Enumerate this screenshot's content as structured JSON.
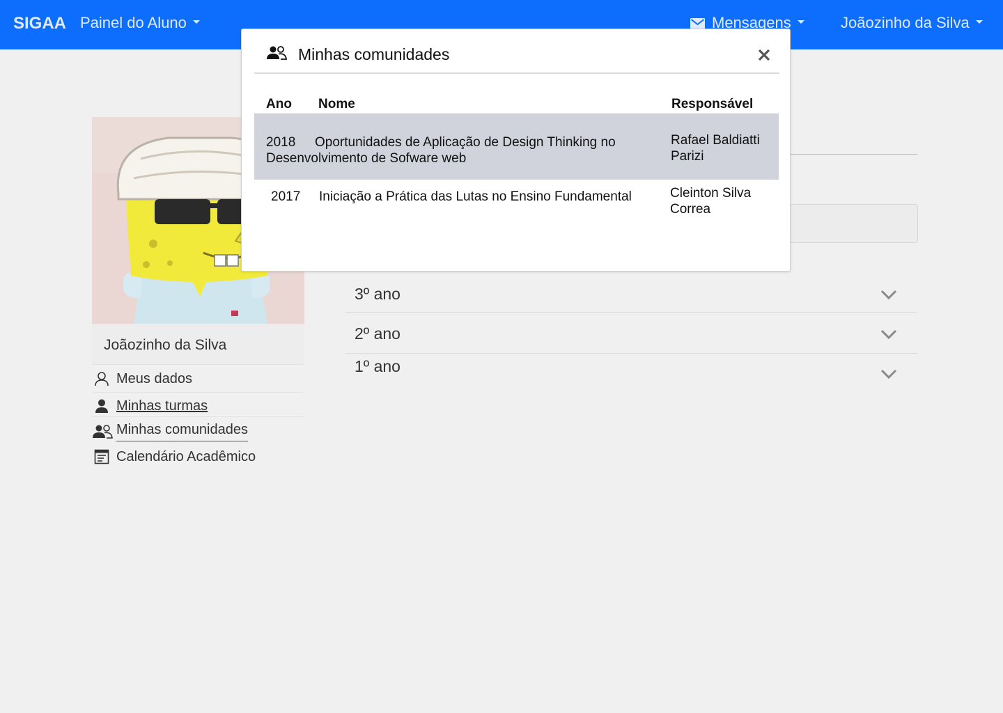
{
  "navbar": {
    "brand": "SIGAA",
    "panel_label": "Painel do Aluno",
    "messages_label": "Mensagens",
    "user_label": "Joãozinho da Silva",
    "color": "#0d6efd"
  },
  "profile": {
    "name": "Joãozinho da Silva"
  },
  "sidebar": {
    "items": [
      {
        "label": "Meus dados",
        "icon": "person-outline-icon"
      },
      {
        "label": "Minhas turmas",
        "icon": "person-filled-icon"
      },
      {
        "label": "Minhas comunidades",
        "icon": "people-icon"
      },
      {
        "label": "Calendário Acadêmico",
        "icon": "calendar-icon"
      }
    ]
  },
  "accordion": {
    "items": [
      {
        "label": "3º ano"
      },
      {
        "label": "2º ano"
      },
      {
        "label": "1º ano"
      }
    ]
  },
  "modal": {
    "title": "Minhas comunidades",
    "columns": {
      "year": "Ano",
      "name": "Nome",
      "owner": "Responsável"
    },
    "rows": [
      {
        "year": "2018",
        "name_line1": "Oportunidades de Aplicação de Design Thinking no",
        "name_line2": "Desenvolvimento de Sofware web",
        "owner_line1": "Rafael Baldiatti",
        "owner_line2": "Parizi"
      },
      {
        "year": "2017",
        "name_line1": "Iniciação a Prática das Lutas no Ensino Fundamental",
        "owner_line1": "Cleinton Silva",
        "owner_line2": "Correa"
      }
    ],
    "highlight_color": "#d0d3db"
  }
}
